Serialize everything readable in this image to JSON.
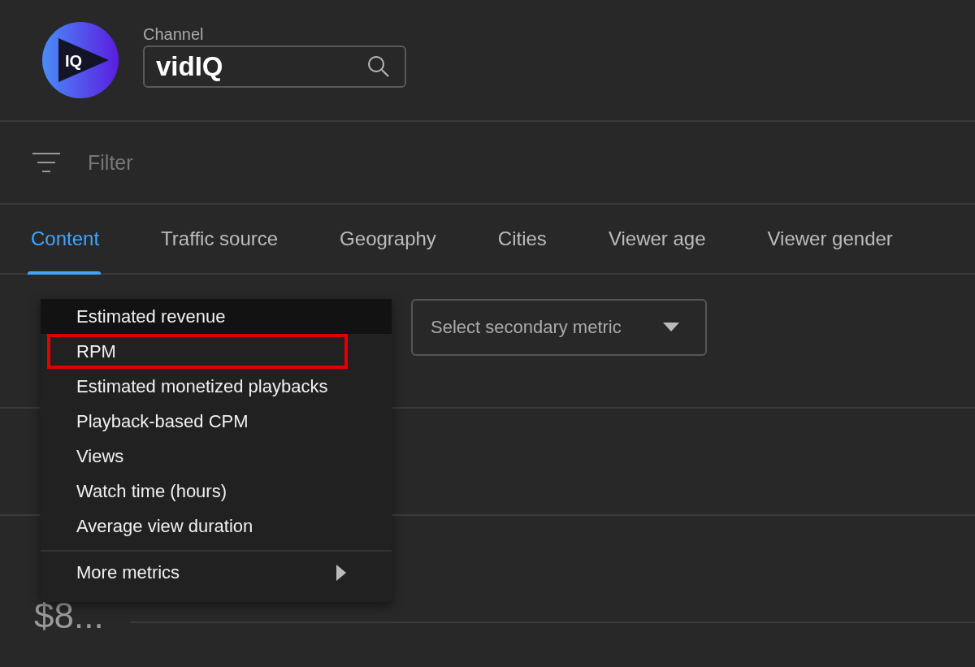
{
  "channel": {
    "label": "Channel",
    "search_value": "vidIQ",
    "logo_text": "IQ"
  },
  "filter": {
    "placeholder": "Filter"
  },
  "tabs": [
    {
      "label": "Content",
      "selected": true
    },
    {
      "label": "Traffic source",
      "selected": false
    },
    {
      "label": "Geography",
      "selected": false
    },
    {
      "label": "Cities",
      "selected": false
    },
    {
      "label": "Viewer age",
      "selected": false
    },
    {
      "label": "Viewer gender",
      "selected": false
    }
  ],
  "secondary_metric": {
    "placeholder": "Select secondary metric"
  },
  "metric_menu": {
    "items": [
      {
        "label": "Estimated revenue",
        "selected": true,
        "annotated": false
      },
      {
        "label": "RPM",
        "selected": false,
        "annotated": true
      },
      {
        "label": "Estimated monetized playbacks",
        "selected": false,
        "annotated": false
      },
      {
        "label": "Playback-based CPM",
        "selected": false,
        "annotated": false
      },
      {
        "label": "Views",
        "selected": false,
        "annotated": false
      },
      {
        "label": "Watch time (hours)",
        "selected": false,
        "annotated": false
      },
      {
        "label": "Average view duration",
        "selected": false,
        "annotated": false
      }
    ],
    "more": {
      "label": "More metrics"
    }
  },
  "rows": [
    {
      "value": "$8..."
    }
  ]
}
